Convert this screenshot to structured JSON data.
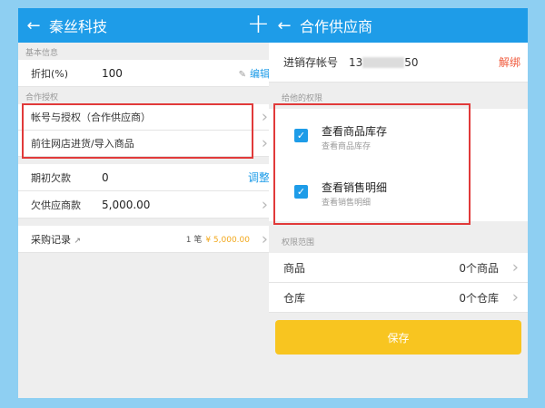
{
  "colors": {
    "background": "#8ecff2",
    "accent": "#1e9ce8",
    "highlight": "#e13a3a",
    "save": "#f8c520",
    "unbind": "#f05a3c",
    "amount": "#f2a81d"
  },
  "left": {
    "header": {
      "back_icon": "arrow-left",
      "title": "秦丝科技",
      "add_icon": "plus"
    },
    "basic_label": "基本信息",
    "discount": {
      "label": "折扣(%)",
      "value": "100",
      "edit": "编辑"
    },
    "coop_label": "合作授权",
    "coop_items": [
      {
        "label": "帐号与授权（合作供应商）"
      },
      {
        "label": "前往网店进货/导入商品"
      }
    ],
    "initial_debt": {
      "label": "期初欠款",
      "value": "0",
      "action": "调整"
    },
    "owed": {
      "label": "欠供应商款",
      "value": "5,000.00"
    },
    "records": {
      "label": "采购记录",
      "count": "1 笔",
      "amount": "¥ 5,000.00"
    }
  },
  "right": {
    "header": {
      "back_icon": "arrow-left",
      "title": "合作供应商"
    },
    "account": {
      "label": "进销存帐号",
      "prefix": "13",
      "suffix": "50",
      "unbind": "解绑"
    },
    "perm_label": "给他的权限",
    "perms": [
      {
        "title": "查看商品库存",
        "sub": "查看商品库存",
        "checked": true
      },
      {
        "title": "查看销售明细",
        "sub": "查看销售明细",
        "checked": true
      }
    ],
    "range_label": "权限范围",
    "ranges": [
      {
        "label": "商品",
        "value": "0个商品"
      },
      {
        "label": "仓库",
        "value": "0个仓库"
      }
    ],
    "save": "保存"
  }
}
